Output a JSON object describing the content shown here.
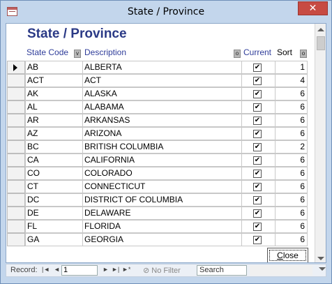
{
  "window": {
    "title": "State / Province",
    "close_glyph": "✕"
  },
  "form": {
    "title": "State / Province"
  },
  "columns": {
    "code": "State Code",
    "description": "Description",
    "current": "Current",
    "sort": "Sort",
    "code_sort_glyph": "v",
    "desc_sort_glyph": "o",
    "sort_sort_glyph": "o"
  },
  "rows": [
    {
      "code": "AB",
      "description": "ALBERTA",
      "current": true,
      "sort": "1"
    },
    {
      "code": "ACT",
      "description": "ACT",
      "current": true,
      "sort": "4"
    },
    {
      "code": "AK",
      "description": "ALASKA",
      "current": true,
      "sort": "6"
    },
    {
      "code": "AL",
      "description": "ALABAMA",
      "current": true,
      "sort": "6"
    },
    {
      "code": "AR",
      "description": "ARKANSAS",
      "current": true,
      "sort": "6"
    },
    {
      "code": "AZ",
      "description": "ARIZONA",
      "current": true,
      "sort": "6"
    },
    {
      "code": "BC",
      "description": "BRITISH COLUMBIA",
      "current": true,
      "sort": "2"
    },
    {
      "code": "CA",
      "description": "CALIFORNIA",
      "current": true,
      "sort": "6"
    },
    {
      "code": "CO",
      "description": "COLORADO",
      "current": true,
      "sort": "6"
    },
    {
      "code": "CT",
      "description": "CONNECTICUT",
      "current": true,
      "sort": "6"
    },
    {
      "code": "DC",
      "description": "DISTRICT OF COLUMBIA",
      "current": true,
      "sort": "6"
    },
    {
      "code": "DE",
      "description": "DELAWARE",
      "current": true,
      "sort": "6"
    },
    {
      "code": "FL",
      "description": "FLORIDA",
      "current": true,
      "sort": "6"
    },
    {
      "code": "GA",
      "description": "GEORGIA",
      "current": true,
      "sort": "6"
    }
  ],
  "buttons": {
    "close_prefix": "",
    "close_underlined": "C",
    "close_rest": "lose"
  },
  "navigation": {
    "record_label": "Record:",
    "first": "|◄",
    "prev": "◄",
    "record_value": "1",
    "next": "►",
    "last": "►|",
    "new": "►*",
    "no_filter": "No Filter",
    "search_placeholder": "Search"
  },
  "icons": {
    "checked": "✔"
  },
  "colors": {
    "accent": "#2b3a86",
    "header_text": "#2f3d9a",
    "close_button": "#c74b43"
  }
}
